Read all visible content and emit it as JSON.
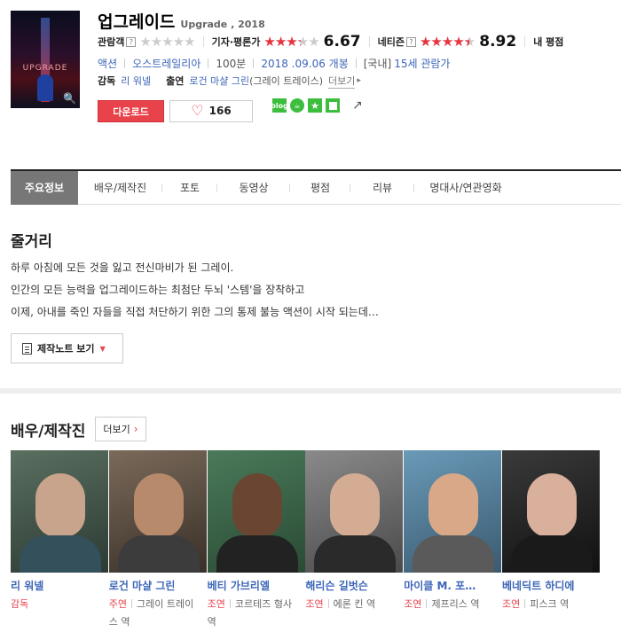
{
  "movie": {
    "title": "업그레이드",
    "sub": "Upgrade , 2018",
    "poster_text": "UPGRADE"
  },
  "ratings": [
    {
      "label": "관람객",
      "stars": 0,
      "score": ""
    },
    {
      "label": "기자·평론가",
      "stars": 0.667,
      "score": "6.67"
    },
    {
      "label": "네티즌",
      "stars": 0.892,
      "score": "8.92"
    },
    {
      "label": "내 평점",
      "stars": null,
      "score": ""
    }
  ],
  "info": {
    "genre": "액션",
    "country": "오스트레일리아",
    "runtime": "100분",
    "release": "2018 .09.06 개봉",
    "grade_prefix": "[국내]",
    "grade": "15세 관람가"
  },
  "crew_line": {
    "director_label": "감독",
    "director": "리 워넬",
    "cast_label": "출연",
    "cast": "로건 마샬 그린",
    "cast_rest": "(그레이 트레이스)",
    "more": "더보기"
  },
  "buttons": {
    "download": "다운로드",
    "like_count": "166"
  },
  "share": {
    "blog": "blog"
  },
  "tabs": [
    "주요정보",
    "배우/제작진",
    "포토",
    "동영상",
    "평점",
    "리뷰",
    "명대사/연관영화"
  ],
  "synopsis": {
    "title": "줄거리",
    "lines": [
      "하루 아침에 모든 것을 잃고 전신마비가 된 그레이.",
      " 인간의 모든 능력을 업그레이드하는 최첨단 두뇌 '스템'을 장착하고",
      " 이제, 아내를 죽인 자들을 직접 처단하기 위한 그의 통제 불능 액션이 시작 되는데…"
    ],
    "note_button": "제작노트 보기"
  },
  "crew": {
    "title": "배우/제작진",
    "more": "더보기",
    "people": [
      {
        "name": "리 워넬",
        "type": "감독",
        "role": ""
      },
      {
        "name": "로건 마샬 그린",
        "type": "주연",
        "role": "그레이 트레이스 역"
      },
      {
        "name": "베티 가브리엘",
        "type": "조연",
        "role": "코르테즈 형사 역"
      },
      {
        "name": "해리슨 길벗슨",
        "type": "조연",
        "role": "에론 킨 역"
      },
      {
        "name": "마이클 M. 포…",
        "type": "조연",
        "role": "제프리스 역"
      },
      {
        "name": "베네딕트 하디에",
        "type": "조연",
        "role": "피스크 역"
      }
    ]
  },
  "colors": {
    "accent": "#e8424a",
    "link": "#3d66b8",
    "tab_active": "#777777"
  }
}
